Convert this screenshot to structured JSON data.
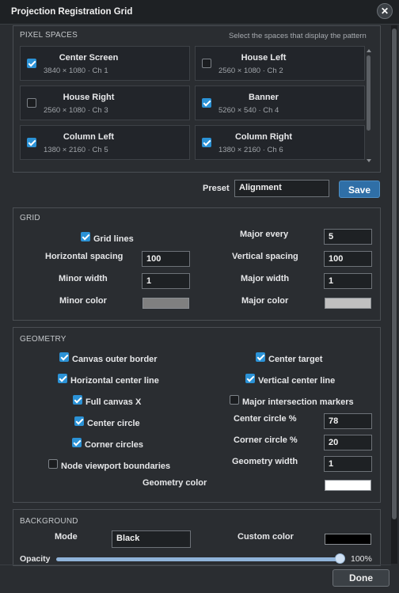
{
  "window": {
    "title": "Projection Registration Grid"
  },
  "pixel_spaces": {
    "title": "PIXEL SPACES",
    "hint": "Select the spaces that display the pattern",
    "items": [
      {
        "name": "Center Screen",
        "sub": "3840 × 1080 · Ch 1",
        "checked": true
      },
      {
        "name": "House Left",
        "sub": "2560 × 1080 · Ch 2",
        "checked": false
      },
      {
        "name": "House Right",
        "sub": "2560 × 1080 · Ch 3",
        "checked": false
      },
      {
        "name": "Banner",
        "sub": "5260 × 540 · Ch 4",
        "checked": true
      },
      {
        "name": "Column Left",
        "sub": "1380 × 2160 · Ch 5",
        "checked": true
      },
      {
        "name": "Column Right",
        "sub": "1380 × 2160 · Ch 6",
        "checked": true
      }
    ]
  },
  "preset": {
    "label": "Preset",
    "value": "Alignment",
    "save_label": "Save"
  },
  "grid": {
    "title": "GRID",
    "grid_lines_label": "Grid lines",
    "grid_lines_checked": true,
    "major_every_label": "Major every",
    "major_every": "5",
    "h_spacing_label": "Horizontal spacing",
    "h_spacing": "100",
    "v_spacing_label": "Vertical spacing",
    "v_spacing": "100",
    "minor_width_label": "Minor width",
    "minor_width": "1",
    "major_width_label": "Major width",
    "major_width": "1",
    "minor_color_label": "Minor color",
    "minor_color": "#808080",
    "major_color_label": "Major color",
    "major_color": "#c0c0c0"
  },
  "geometry": {
    "title": "GEOMETRY",
    "canvas_outer_border": {
      "label": "Canvas outer border",
      "checked": true
    },
    "center_target": {
      "label": "Center target",
      "checked": true
    },
    "horizontal_center_line": {
      "label": "Horizontal center line",
      "checked": true
    },
    "vertical_center_line": {
      "label": "Vertical center line",
      "checked": true
    },
    "full_canvas_x": {
      "label": "Full canvas X",
      "checked": true
    },
    "major_intersection_markers": {
      "label": "Major intersection markers",
      "checked": false
    },
    "center_circle": {
      "label": "Center circle",
      "checked": true
    },
    "corner_circles": {
      "label": "Corner circles",
      "checked": true
    },
    "node_viewport_boundaries": {
      "label": "Node viewport boundaries",
      "checked": false
    },
    "center_circle_pct_label": "Center circle %",
    "center_circle_pct": "78",
    "corner_circle_pct_label": "Corner circle %",
    "corner_circle_pct": "20",
    "geometry_width_label": "Geometry width",
    "geometry_width": "1",
    "geometry_color_label": "Geometry color",
    "geometry_color": "#ffffff"
  },
  "background": {
    "title": "BACKGROUND",
    "mode_label": "Mode",
    "mode_value": "Black",
    "custom_color_label": "Custom color",
    "custom_color": "#000000",
    "opacity_label": "Opacity",
    "opacity_value": "100%",
    "opacity_fraction": 1.0
  },
  "footer": {
    "done_label": "Done"
  }
}
